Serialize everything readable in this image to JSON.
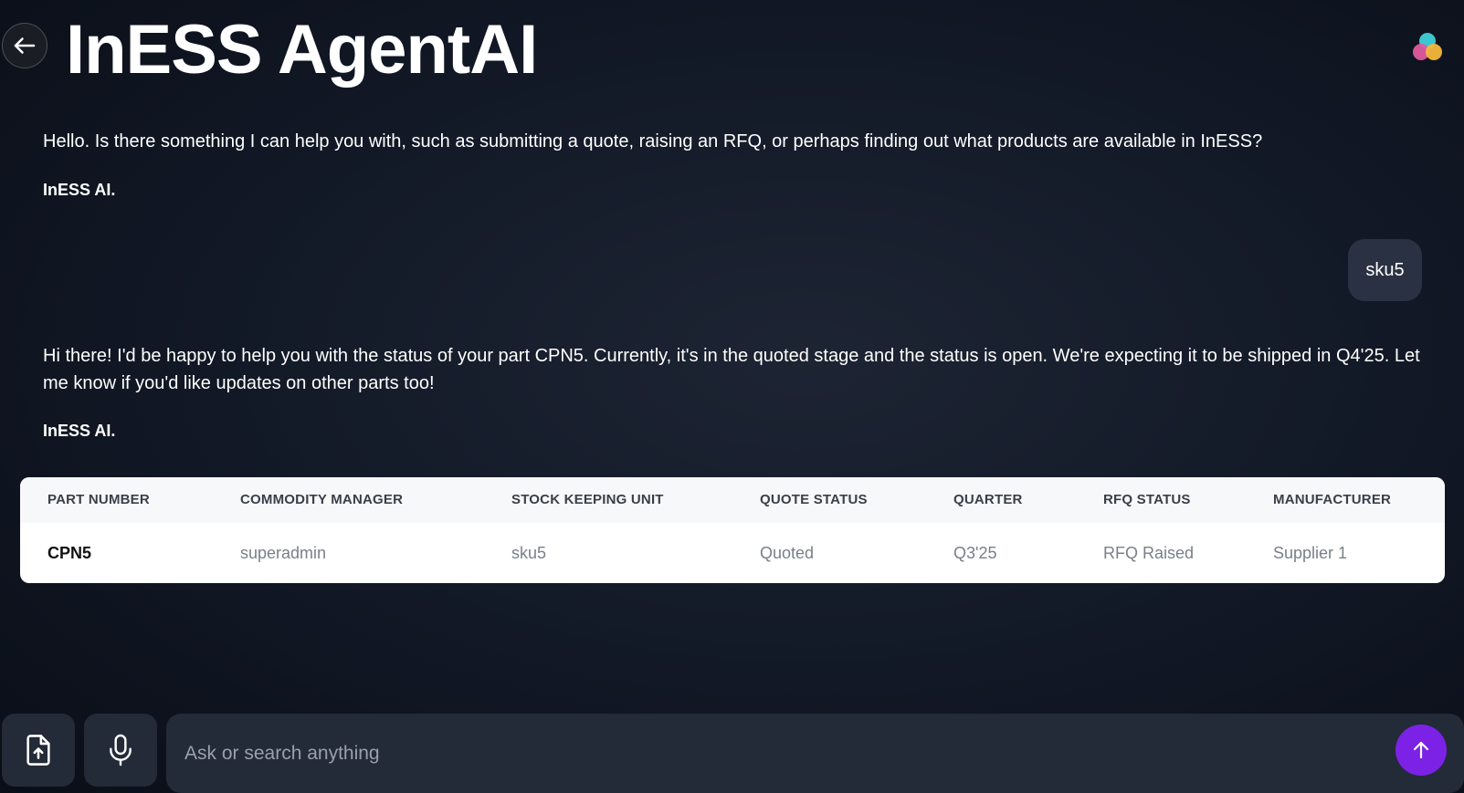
{
  "header": {
    "title": "InESS AgentAI",
    "back_icon": "arrow-left-icon",
    "logo_icon": "three-dot-logo-icon"
  },
  "chat": {
    "messages": [
      {
        "role": "assistant",
        "text": "Hello. Is there something I can help you with, such as submitting a quote, raising an RFQ, or perhaps finding out what products are available in InESS?",
        "signature": "InESS AI."
      },
      {
        "role": "user",
        "text": "sku5"
      },
      {
        "role": "assistant",
        "text": "Hi there! I'd be happy to help you with the status of your part CPN5. Currently, it's in the quoted stage and the status is open. We're expecting it to be shipped in Q4'25. Let me know if you'd like updates on other parts too!",
        "signature": "InESS AI."
      }
    ]
  },
  "table": {
    "headers": [
      "PART NUMBER",
      "COMMODITY MANAGER",
      "STOCK KEEPING UNIT",
      "QUOTE STATUS",
      "QUARTER",
      "RFQ STATUS",
      "MANUFACTURER"
    ],
    "rows": [
      [
        "CPN5",
        "superadmin",
        "sku5",
        "Quoted",
        "Q3'25",
        "RFQ Raised",
        "Supplier 1"
      ]
    ]
  },
  "composer": {
    "placeholder": "Ask or search anything",
    "value": "",
    "upload_icon": "file-upload-icon",
    "mic_icon": "microphone-icon",
    "send_icon": "arrow-up-icon"
  },
  "colors": {
    "accent": "#7c22e6",
    "background": "#131a28",
    "bubble": "#2a3142",
    "input": "#232a38"
  }
}
